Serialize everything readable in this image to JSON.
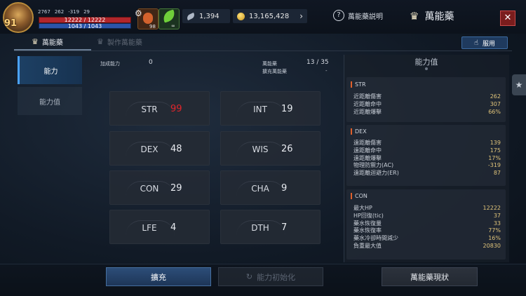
{
  "player": {
    "level": "91",
    "stat1": "2767",
    "stat2": "262",
    "stat3": "-319",
    "stat4": "29",
    "hp_text": "12222 / 12222",
    "mp_text": "1043 / 1043",
    "slot1_count": "98",
    "slot2_count": "∞"
  },
  "currency": {
    "feathers": "1,394",
    "gold": "13,165,428"
  },
  "header": {
    "help_label": "萬能藥説明",
    "title": "萬能藥",
    "close_label": "✕"
  },
  "tabs": [
    {
      "label": "萬能藥"
    },
    {
      "label": "製作萬能藥"
    }
  ],
  "use_button": "服用",
  "nav": [
    {
      "label": "能力"
    },
    {
      "label": "能力值"
    }
  ],
  "info": {
    "added_label": "加成能力",
    "added_value": "0",
    "elixir_label": "萬能藥",
    "elixir_sub": "擴充萬能藥",
    "elixir_value": "13 / 35",
    "elixir_sub_value": "-"
  },
  "stats": [
    {
      "name": "STR",
      "value": "99",
      "highlight": true
    },
    {
      "name": "INT",
      "value": "19",
      "highlight": false
    },
    {
      "name": "DEX",
      "value": "48",
      "highlight": false
    },
    {
      "name": "WIS",
      "value": "26",
      "highlight": false
    },
    {
      "name": "CON",
      "value": "29",
      "highlight": false
    },
    {
      "name": "CHA",
      "value": "9",
      "highlight": false
    },
    {
      "name": "LFE",
      "value": "4",
      "highlight": false
    },
    {
      "name": "DTH",
      "value": "7",
      "highlight": false
    }
  ],
  "panel": {
    "title": "能力值",
    "sections": [
      {
        "title": "STR",
        "rows": [
          {
            "label": "近距離傷害",
            "value": "262"
          },
          {
            "label": "近距離命中",
            "value": "307"
          },
          {
            "label": "近距離爆擊",
            "value": "66%"
          }
        ]
      },
      {
        "title": "DEX",
        "rows": [
          {
            "label": "遠距離傷害",
            "value": "139"
          },
          {
            "label": "遠距離命中",
            "value": "175"
          },
          {
            "label": "遠距離爆擊",
            "value": "17%"
          },
          {
            "label": "物理防禦力(AC)",
            "value": "-319"
          },
          {
            "label": "遠距離迴避力(ER)",
            "value": "87"
          }
        ]
      },
      {
        "title": "CON",
        "rows": [
          {
            "label": "最大HP",
            "value": "12222"
          },
          {
            "label": "HP回復(tic)",
            "value": "37"
          },
          {
            "label": "藥水恢復量",
            "value": "33"
          },
          {
            "label": "藥水恢復率",
            "value": "77%"
          },
          {
            "label": "藥水冷卻時間減少",
            "value": "16%"
          },
          {
            "label": "負重最大值",
            "value": "20830"
          }
        ]
      }
    ]
  },
  "buttons": {
    "expand": "擴充",
    "reset": "能力初始化",
    "status": "萬能藥現狀"
  },
  "colors": {
    "highlight_value": "#e0252b",
    "accent_blue": "#4aa3ff",
    "panel_value": "#e0c47a"
  }
}
